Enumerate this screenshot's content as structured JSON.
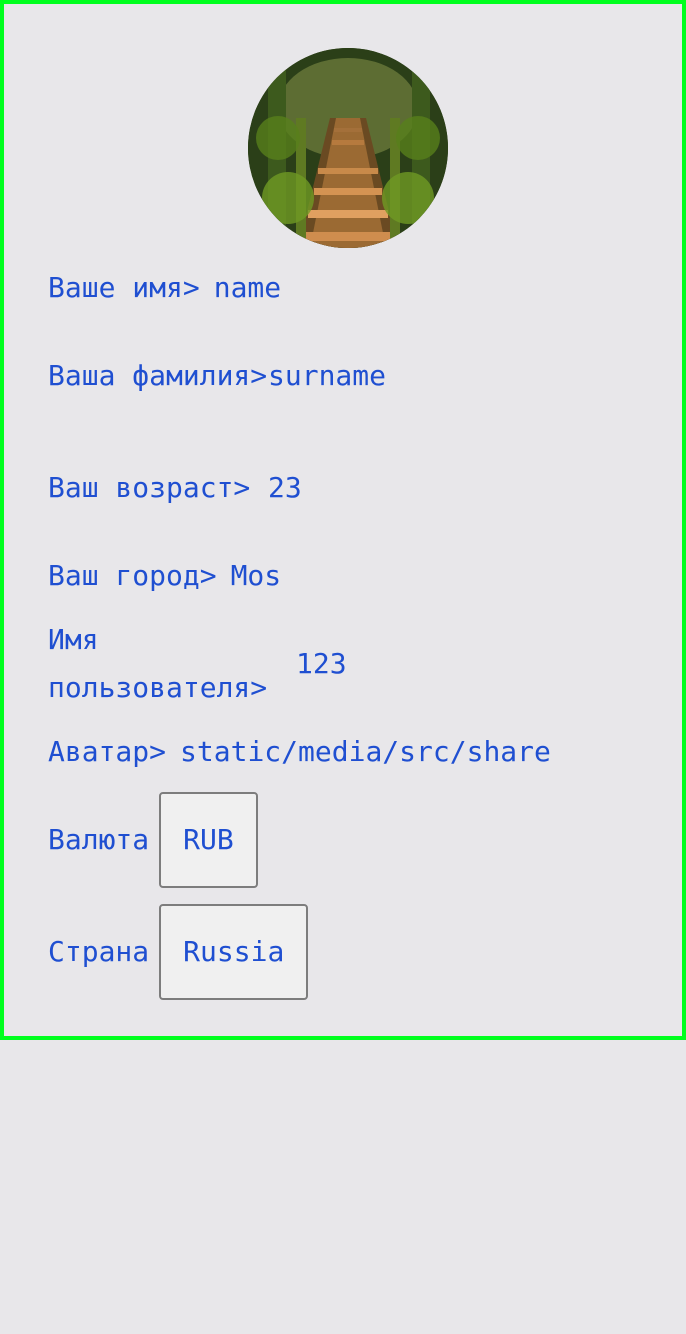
{
  "profile": {
    "avatar_alt": "avatar",
    "fields": {
      "name": {
        "label": "Ваше имя>",
        "value": "name"
      },
      "surname": {
        "label": "Ваша фамилия>",
        "value": "surname"
      },
      "age": {
        "label": "Ваш возраст>",
        "value": "23"
      },
      "city": {
        "label": "Ваш город>",
        "value": "Mos"
      },
      "username": {
        "label": "Имя пользователя>",
        "value": "123"
      },
      "avatar": {
        "label": "Аватар>",
        "value": "static/media/src/share"
      },
      "currency": {
        "label": "Валюта",
        "value": "RUB"
      },
      "country": {
        "label": "Страна",
        "value": "Russia"
      }
    }
  },
  "colors": {
    "frame": "#00ff1e",
    "text": "#1f4fd1",
    "background": "#e8e7ea",
    "pill_border": "#7d7d7d",
    "pill_fill": "#f0f0f0"
  }
}
